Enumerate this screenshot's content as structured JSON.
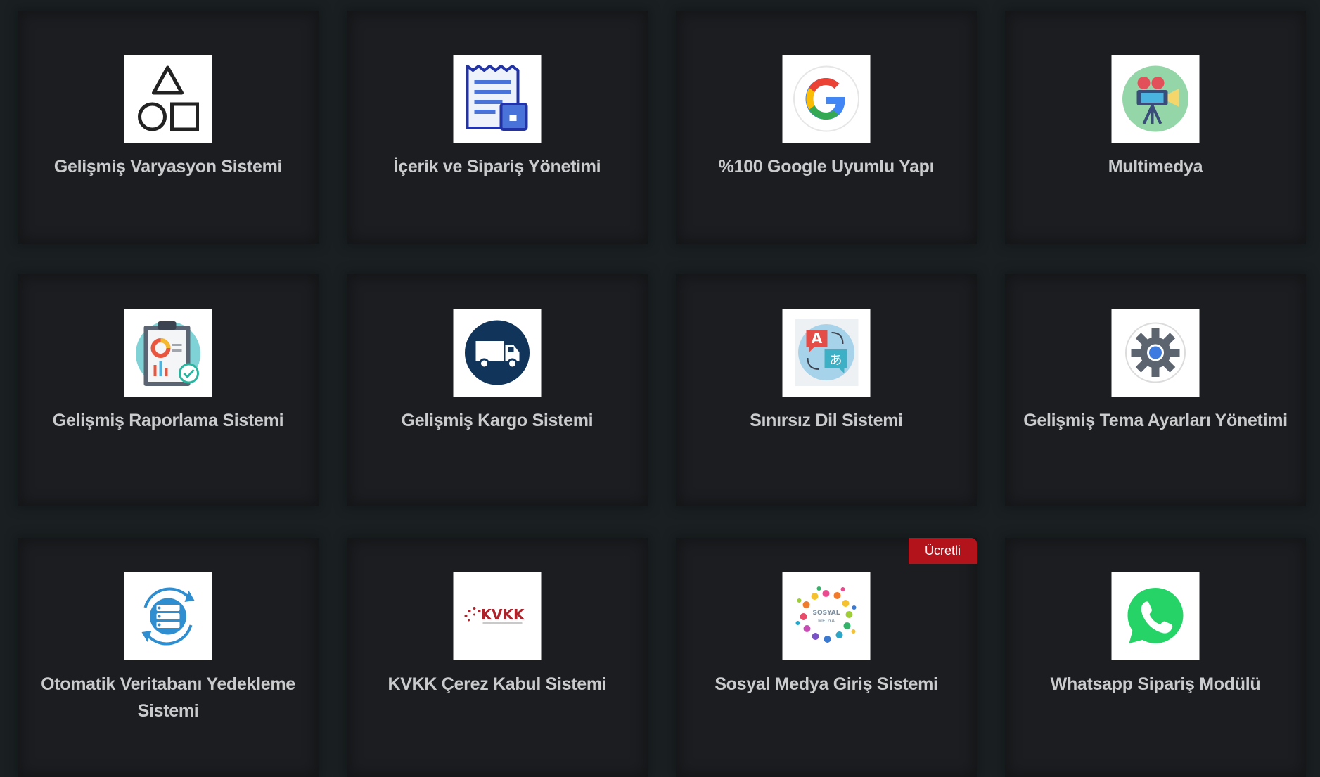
{
  "features": [
    {
      "label": "Gelişmiş Varyasyon Sistemi",
      "icon": "shapes-icon"
    },
    {
      "label": "İçerik ve Sipariş Yönetimi",
      "icon": "receipt-icon"
    },
    {
      "label": "%100 Google Uyumlu Yapı",
      "icon": "google-icon"
    },
    {
      "label": "Multimedya",
      "icon": "projector-icon"
    },
    {
      "label": "Gelişmiş Raporlama Sistemi",
      "icon": "report-clipboard-icon"
    },
    {
      "label": "Gelişmiş Kargo Sistemi",
      "icon": "delivery-truck-icon"
    },
    {
      "label": "Sınırsız Dil Sistemi",
      "icon": "translate-icon"
    },
    {
      "label": "Gelişmiş Tema Ayarları Yönetimi",
      "icon": "gear-icon"
    },
    {
      "label": "Otomatik Veritabanı Yedekleme Sistemi",
      "icon": "database-sync-icon"
    },
    {
      "label": "KVKK Çerez Kabul Sistemi",
      "icon": "kvkk-logo-icon"
    },
    {
      "label": "Sosyal Medya Giriş Sistemi",
      "icon": "social-media-icon",
      "badge": "Ücretli"
    },
    {
      "label": "Whatsapp Sipariş Modülü",
      "icon": "whatsapp-icon"
    }
  ],
  "kvkk_logo_text": "KVKK",
  "translate_letters": [
    "A",
    "あ"
  ],
  "social_media_logo_text": [
    "SOSYAL",
    "MEDYA"
  ],
  "colors": {
    "background": "#161b1d",
    "card": "#1b1d20",
    "label": "#c9cbcd",
    "badge": "#b3141c"
  }
}
